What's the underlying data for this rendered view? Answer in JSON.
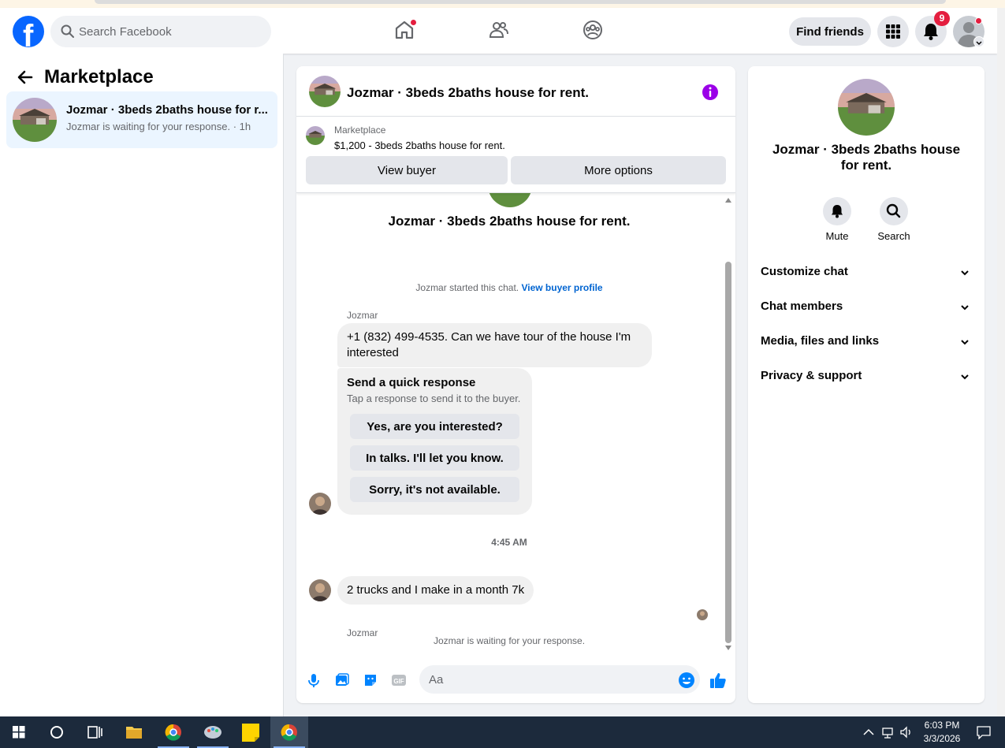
{
  "header": {
    "search_placeholder": "Search Facebook",
    "find_friends_label": "Find friends",
    "notification_count": "9",
    "brand_color": "#0866ff"
  },
  "sidebar": {
    "title": "Marketplace",
    "conversation": {
      "title": "Jozmar · 3beds 2baths house for r...",
      "subtitle": "Jozmar is waiting for your response. · 1h"
    }
  },
  "chat": {
    "header_title": "Jozmar · 3beds 2baths house for rent.",
    "listing": {
      "source": "Marketplace",
      "price_line": "$1,200 - 3beds 2baths house for rent.",
      "view_buyer_label": "View buyer",
      "more_options_label": "More options"
    },
    "listing_title": "Jozmar · 3beds 2baths house for rent.",
    "started_text": "Jozmar started this chat.",
    "view_profile_link": "View buyer profile",
    "messages": [
      {
        "sender": "Jozmar",
        "text": "+1 (832) 499-4535.   Can we have tour of the house I'm interested"
      },
      {
        "sender": "Jozmar",
        "text": "2 trucks and I make in a month 7k"
      }
    ],
    "quick_response": {
      "title": "Send a quick response",
      "subtitle": "Tap a response to send it to the buyer.",
      "options": [
        "Yes, are you interested?",
        "In talks. I'll let you know.",
        "Sorry, it's not available."
      ]
    },
    "timestamp": "4:45 AM",
    "waiting_text": "Jozmar is waiting for your response.",
    "composer_placeholder": "Aa",
    "accent_color": "#0084ff"
  },
  "info_panel": {
    "title": "Jozmar · 3beds 2baths house for rent.",
    "actions": [
      {
        "label": "Mute",
        "icon": "bell-icon"
      },
      {
        "label": "Search",
        "icon": "search-icon"
      }
    ],
    "sections": [
      "Customize chat",
      "Chat members",
      "Media, files and links",
      "Privacy & support"
    ]
  },
  "taskbar": {
    "time": "6:03 PM",
    "date": "3/3/2026"
  }
}
